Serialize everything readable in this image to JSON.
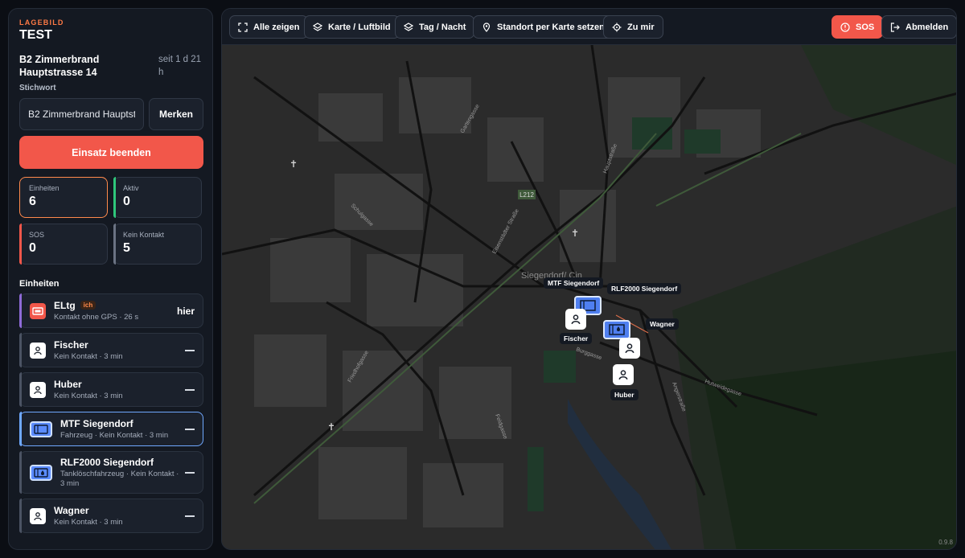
{
  "sidebar": {
    "eyebrow": "LAGEBILD",
    "title": "TEST",
    "incident_name": "B2 Zimmerbrand Hauptstrasse 14",
    "incident_time": "seit 1 d 21 h",
    "keyword_label": "Stichwort",
    "keyword_value": "B2 Zimmerbrand Hauptstr",
    "remember_label": "Merken",
    "end_label": "Einsatz beenden",
    "stats": [
      {
        "label": "Einheiten",
        "value": "6"
      },
      {
        "label": "Aktiv",
        "value": "0"
      },
      {
        "label": "SOS",
        "value": "0"
      },
      {
        "label": "Kein Kontakt",
        "value": "5"
      }
    ],
    "units_heading": "Einheiten",
    "units": [
      {
        "name": "ELtg",
        "badge": "ich",
        "sub": "Kontakt ohne GPS · 26 s",
        "right": "hier"
      },
      {
        "name": "Fischer",
        "sub": "Kein Kontakt · 3 min"
      },
      {
        "name": "Huber",
        "sub": "Kein Kontakt · 3 min"
      },
      {
        "name": "MTF Siegendorf",
        "sub": "Fahrzeug · Kein Kontakt · 3 min"
      },
      {
        "name": "RLF2000 Siegendorf",
        "sub": "Tanklöschfahrzeug · Kein Kontakt · 3 min"
      },
      {
        "name": "Wagner",
        "sub": "Kein Kontakt · 3 min"
      }
    ]
  },
  "toolbar": {
    "show_all": "Alle zeigen",
    "map_layer": "Karte / Luftbild",
    "day_night": "Tag / Nacht",
    "set_location": "Standort per Karte setzen",
    "to_me": "Zu mir",
    "sos": "SOS",
    "logout": "Abmelden"
  },
  "map": {
    "version": "0.9.8",
    "place_label": "Siegendorf/ Cin",
    "road_label": "L212",
    "street_labels": [
      "Eisenstädter Straße",
      "Schulgasse",
      "Hauptstraße",
      "Burggasse",
      "Angerstraße",
      "Hutweidegasse",
      "Friedhofgasse",
      "Gartengasse",
      "Feldgasse"
    ],
    "markers": [
      {
        "label": "MTF Siegendorf"
      },
      {
        "label": "RLF2000 Siegendorf"
      },
      {
        "label": "Wagner"
      },
      {
        "label": "Fischer"
      },
      {
        "label": "Huber"
      }
    ]
  },
  "colors": {
    "accent": "#f2574a",
    "selected": "#6fa8ff",
    "active": "#2fc77b",
    "map_bg": "#2a2a2a"
  }
}
